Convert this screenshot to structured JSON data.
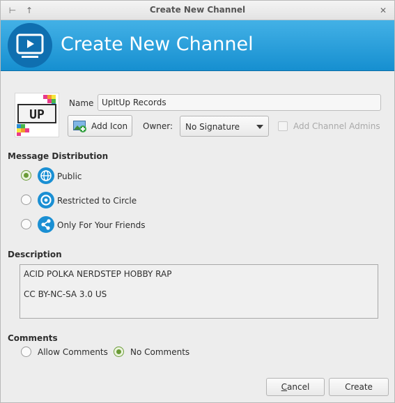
{
  "window": {
    "title": "Create New Channel",
    "pin_glyph": "⊢",
    "up_glyph": "↑",
    "close_glyph": "✕"
  },
  "header": {
    "title": "Create New Channel",
    "icon": "tv-play-icon"
  },
  "channel": {
    "icon": "upitup-logo",
    "logo_text": "UP",
    "name_label": "Name",
    "name_value": "UpItUp Records",
    "add_icon_label": "Add Icon",
    "owner_label": "Owner:",
    "owner_value": "No Signature",
    "add_admins_label": "Add Channel Admins",
    "add_admins_checked": false
  },
  "distribution": {
    "heading": "Message Distribution",
    "options": [
      {
        "label": "Public",
        "checked": true,
        "icon": "globe-icon"
      },
      {
        "label": "Restricted to Circle",
        "checked": false,
        "icon": "circle-icon"
      },
      {
        "label": "Only For Your Friends",
        "checked": false,
        "icon": "share-icon"
      }
    ]
  },
  "description": {
    "heading": "Description",
    "lines": [
      "ACID POLKA NERDSTEP HOBBY RAP",
      "CC BY-NC-SA 3.0 US"
    ]
  },
  "comments": {
    "heading": "Comments",
    "allow_label": "Allow Comments",
    "allow_checked": false,
    "no_label": "No Comments",
    "no_checked": true
  },
  "buttons": {
    "cancel": "Cancel",
    "cancel_mnemonic": "C",
    "cancel_rest": "ancel",
    "create": "Create"
  },
  "colors": {
    "header_top": "#43b1e6",
    "header_bottom": "#168fd0",
    "radio_checked": "#6a9b36"
  }
}
